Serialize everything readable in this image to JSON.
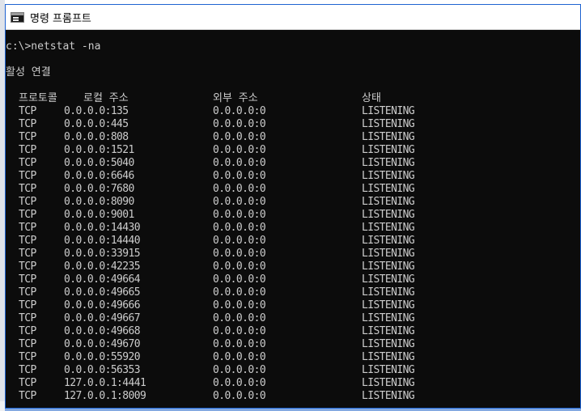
{
  "window": {
    "title": "명령 프롬프트"
  },
  "console": {
    "command_line": "c:\\>netstat -na",
    "section_title": "활성 연결",
    "headers": {
      "proto": "프로토콜",
      "local": "로컬 주소",
      "foreign": "외부 주소",
      "state": "상태"
    },
    "rows": [
      {
        "proto": "TCP",
        "local": "0.0.0.0:135",
        "foreign": "0.0.0.0:0",
        "state": "LISTENING"
      },
      {
        "proto": "TCP",
        "local": "0.0.0.0:445",
        "foreign": "0.0.0.0:0",
        "state": "LISTENING"
      },
      {
        "proto": "TCP",
        "local": "0.0.0.0:808",
        "foreign": "0.0.0.0:0",
        "state": "LISTENING"
      },
      {
        "proto": "TCP",
        "local": "0.0.0.0:1521",
        "foreign": "0.0.0.0:0",
        "state": "LISTENING"
      },
      {
        "proto": "TCP",
        "local": "0.0.0.0:5040",
        "foreign": "0.0.0.0:0",
        "state": "LISTENING"
      },
      {
        "proto": "TCP",
        "local": "0.0.0.0:6646",
        "foreign": "0.0.0.0:0",
        "state": "LISTENING"
      },
      {
        "proto": "TCP",
        "local": "0.0.0.0:7680",
        "foreign": "0.0.0.0:0",
        "state": "LISTENING"
      },
      {
        "proto": "TCP",
        "local": "0.0.0.0:8090",
        "foreign": "0.0.0.0:0",
        "state": "LISTENING"
      },
      {
        "proto": "TCP",
        "local": "0.0.0.0:9001",
        "foreign": "0.0.0.0:0",
        "state": "LISTENING"
      },
      {
        "proto": "TCP",
        "local": "0.0.0.0:14430",
        "foreign": "0.0.0.0:0",
        "state": "LISTENING"
      },
      {
        "proto": "TCP",
        "local": "0.0.0.0:14440",
        "foreign": "0.0.0.0:0",
        "state": "LISTENING"
      },
      {
        "proto": "TCP",
        "local": "0.0.0.0:33915",
        "foreign": "0.0.0.0:0",
        "state": "LISTENING"
      },
      {
        "proto": "TCP",
        "local": "0.0.0.0:42235",
        "foreign": "0.0.0.0:0",
        "state": "LISTENING"
      },
      {
        "proto": "TCP",
        "local": "0.0.0.0:49664",
        "foreign": "0.0.0.0:0",
        "state": "LISTENING"
      },
      {
        "proto": "TCP",
        "local": "0.0.0.0:49665",
        "foreign": "0.0.0.0:0",
        "state": "LISTENING"
      },
      {
        "proto": "TCP",
        "local": "0.0.0.0:49666",
        "foreign": "0.0.0.0:0",
        "state": "LISTENING"
      },
      {
        "proto": "TCP",
        "local": "0.0.0.0:49667",
        "foreign": "0.0.0.0:0",
        "state": "LISTENING"
      },
      {
        "proto": "TCP",
        "local": "0.0.0.0:49668",
        "foreign": "0.0.0.0:0",
        "state": "LISTENING"
      },
      {
        "proto": "TCP",
        "local": "0.0.0.0:49670",
        "foreign": "0.0.0.0:0",
        "state": "LISTENING"
      },
      {
        "proto": "TCP",
        "local": "0.0.0.0:55920",
        "foreign": "0.0.0.0:0",
        "state": "LISTENING"
      },
      {
        "proto": "TCP",
        "local": "0.0.0.0:56353",
        "foreign": "0.0.0.0:0",
        "state": "LISTENING"
      },
      {
        "proto": "TCP",
        "local": "127.0.0.1:4441",
        "foreign": "0.0.0.0:0",
        "state": "LISTENING"
      },
      {
        "proto": "TCP",
        "local": "127.0.0.1:8009",
        "foreign": "0.0.0.0:0",
        "state": "LISTENING"
      }
    ]
  },
  "icons": {
    "window_icon": "command-prompt-icon"
  },
  "colors": {
    "console_background": "#0c0c0c",
    "console_text": "#cccccc",
    "window_border": "#1e63d1"
  }
}
